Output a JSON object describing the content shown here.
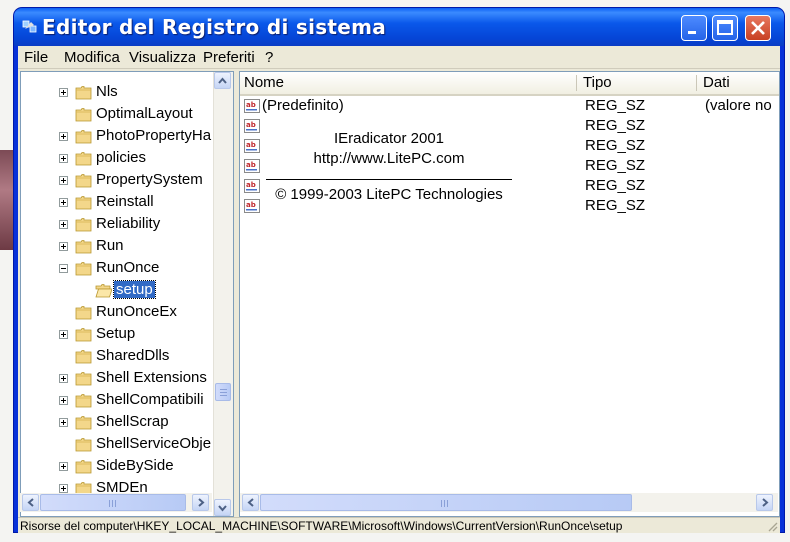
{
  "window": {
    "title": "Editor del Registro di sistema"
  },
  "menu": [
    "File",
    "Modifica",
    "Visualizza",
    "Preferiti",
    "?"
  ],
  "tree": [
    {
      "label": "Nls",
      "expander": "plus"
    },
    {
      "label": "OptimalLayout",
      "expander": "none"
    },
    {
      "label": "PhotoPropertyHa",
      "expander": "plus"
    },
    {
      "label": "policies",
      "expander": "plus"
    },
    {
      "label": "PropertySystem",
      "expander": "plus"
    },
    {
      "label": "Reinstall",
      "expander": "plus"
    },
    {
      "label": "Reliability",
      "expander": "plus"
    },
    {
      "label": "Run",
      "expander": "plus"
    },
    {
      "label": "RunOnce",
      "expander": "minus"
    },
    {
      "label": "setup",
      "expander": "none",
      "selected": true,
      "child": true
    },
    {
      "label": "RunOnceEx",
      "expander": "none"
    },
    {
      "label": "Setup",
      "expander": "plus"
    },
    {
      "label": "SharedDlls",
      "expander": "none"
    },
    {
      "label": "Shell Extensions",
      "expander": "plus"
    },
    {
      "label": "ShellCompatibili",
      "expander": "plus"
    },
    {
      "label": "ShellScrap",
      "expander": "plus"
    },
    {
      "label": "ShellServiceObje",
      "expander": "none"
    },
    {
      "label": "SideBySide",
      "expander": "plus"
    },
    {
      "label": "SMDEn",
      "expander": "plus"
    }
  ],
  "columns": {
    "name": "Nome",
    "type": "Tipo",
    "data": "Dati"
  },
  "values": [
    {
      "name": "(Predefinito)",
      "type": "REG_SZ",
      "data": "(valore no"
    },
    {
      "name": "",
      "type": "REG_SZ",
      "data": ""
    },
    {
      "name": "",
      "type": "REG_SZ",
      "data": ""
    },
    {
      "name": "",
      "type": "REG_SZ",
      "data": ""
    },
    {
      "name": "",
      "type": "REG_SZ",
      "data": ""
    },
    {
      "name": "",
      "type": "REG_SZ",
      "data": ""
    }
  ],
  "about": {
    "product": "IEradicator 2001",
    "url": "http://www.LitePC.com",
    "copyright": "© 1999-2003 LitePC Technologies"
  },
  "status": "Risorse del computer\\HKEY_LOCAL_MACHINE\\SOFTWARE\\Microsoft\\Windows\\CurrentVersion\\RunOnce\\setup",
  "colors": {
    "titlebar": "#0A58EA",
    "selection": "#316AC5",
    "window_bg": "#ECE9D8"
  },
  "icons": {
    "title": "regedit-icon",
    "folder": "folder-icon",
    "value": "string-value-icon"
  }
}
